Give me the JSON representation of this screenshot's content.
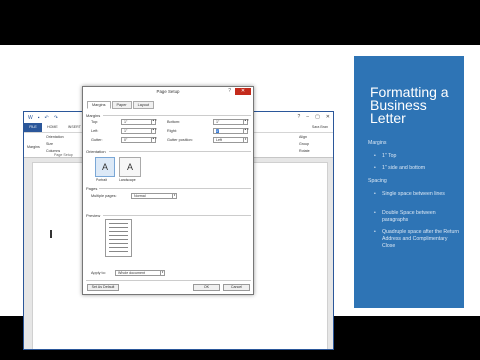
{
  "word": {
    "title": "Document1 - Word",
    "qa_icons": [
      "save-icon",
      "undo-icon",
      "redo-icon"
    ],
    "tabs": [
      "FILE",
      "HOME",
      "INSERT",
      "DESIGN",
      "PAGE LAYOUT",
      "REFERENCES",
      "MAILINGS",
      "REVIEW",
      "VIEW"
    ],
    "user": "Sara Bran",
    "ribbon": {
      "margins": "Margins",
      "orientation": "Orientation",
      "size": "Size",
      "columns": "Columns",
      "page_setup_group": "Page Setup",
      "align": "Align",
      "group": "Group",
      "rotate": "Rotate"
    }
  },
  "dialog": {
    "title": "Page Setup",
    "help": "?",
    "close": "✕",
    "tabs": [
      "Margins",
      "Paper",
      "Layout"
    ],
    "margins_section": "Margins",
    "top_label": "Top:",
    "top_value": "1\"",
    "bottom_label": "Bottom:",
    "bottom_value": "1\"",
    "left_label": "Left:",
    "left_value": "1\"",
    "right_label": "Right:",
    "right_value": "1\"",
    "gutter_label": "Gutter:",
    "gutter_value": "0\"",
    "gutter_pos_label": "Gutter position:",
    "gutter_pos_value": "Left",
    "orientation_section": "Orientation",
    "portrait": "Portrait",
    "landscape": "Landscape",
    "pages_section": "Pages",
    "multiple_pages_label": "Multiple pages:",
    "multiple_pages_value": "Normal",
    "preview_section": "Preview",
    "apply_to_label": "Apply to:",
    "apply_to_value": "Whole document",
    "set_default": "Set As Default",
    "ok": "OK",
    "cancel": "Cancel"
  },
  "side": {
    "title": "Formatting a Business Letter",
    "margins": "Margins",
    "m1": "1\" Top",
    "m2": "1\" side and bottom",
    "spacing": "Spacing",
    "s1": "Single space between lines",
    "s2": "Double Space between paragraphs",
    "s3": "Quadruple space after the Return Address and Complimentary Close"
  },
  "colors": {
    "accent": "#2e74b5",
    "word_blue": "#2b579a",
    "close_red": "#c42b1c"
  }
}
